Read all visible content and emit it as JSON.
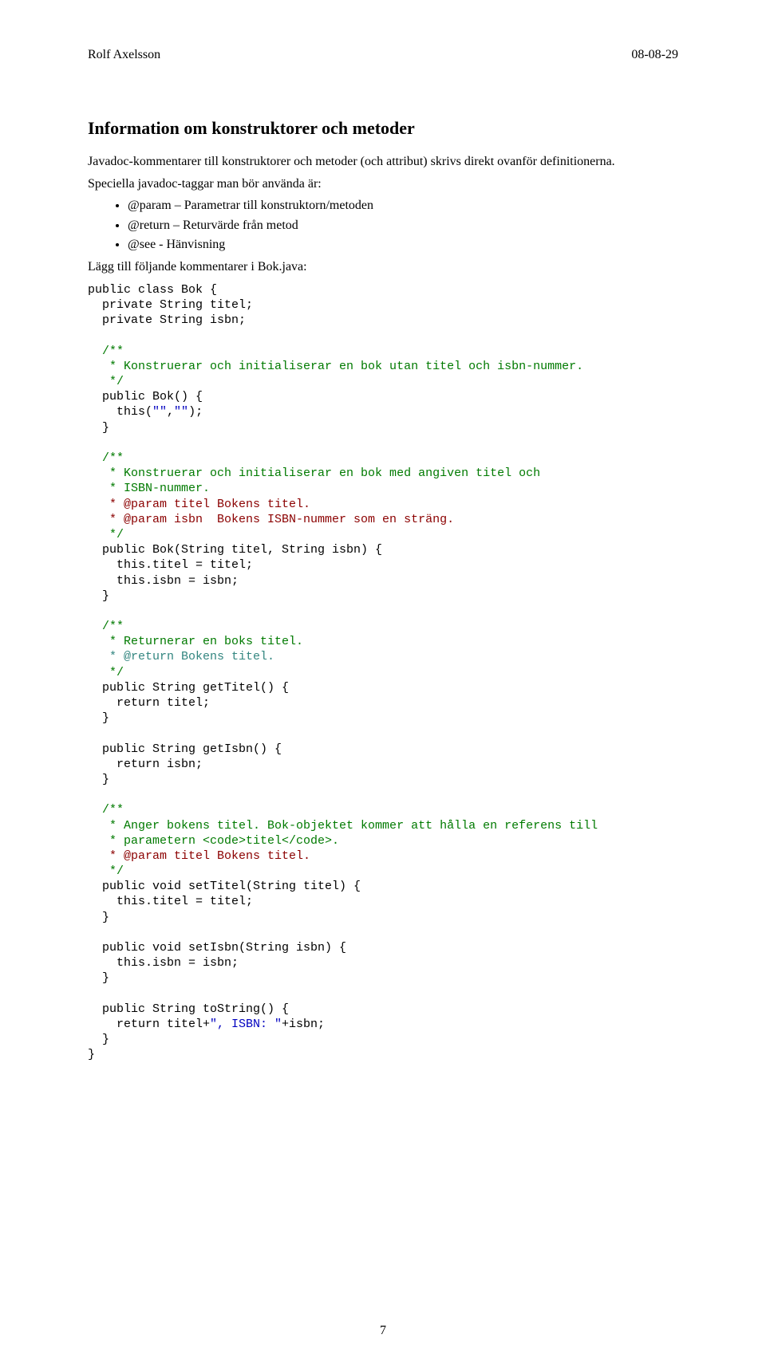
{
  "header": {
    "author": "Rolf Axelsson",
    "date": "08-08-29"
  },
  "title": "Information om konstruktorer och metoder",
  "intro": "Javadoc-kommentarer till konstruktorer och metoder (och attribut) skrivs direkt ovanför definitionerna.",
  "tagLead": "Speciella javadoc-taggar man bör använda är:",
  "bullets": [
    "@param – Parametrar till konstruktorn/metoden",
    "@return – Returvärde från metod",
    "@see - Hänvisning"
  ],
  "preCode": "Lägg till följande kommentarer i Bok.java:",
  "code": {
    "l01": "public class Bok {",
    "l02": "  private String titel;",
    "l03": "  private String isbn;",
    "l04a": "  /**",
    "l04b": "   * Konstruerar och initialiserar en bok utan titel och isbn-nummer.",
    "l04c": "   */",
    "l05": "  public Bok() {",
    "l06a": "    this(",
    "l06b": "\"\"",
    "l06c": ",",
    "l06d": "\"\"",
    "l06e": ");",
    "l07": "  }",
    "l08a": "  /**",
    "l08b": "   * Konstruerar och initialiserar en bok med angiven titel och ",
    "l08c": "   * ISBN-nummer.",
    "l08d": "   * @param titel Bokens titel.",
    "l08e": "   * @param isbn  Bokens ISBN-nummer som en sträng.",
    "l08f": "   */",
    "l09": "  public Bok(String titel, String isbn) {",
    "l10": "    this.titel = titel;",
    "l11": "    this.isbn = isbn;",
    "l12": "  }",
    "l13a": "  /**",
    "l13b": "   * Returnerar en boks titel.",
    "l13c": "   * @return Bokens titel.",
    "l13d": "   */",
    "l14": "  public String getTitel() {",
    "l15": "    return titel;",
    "l16": "  }",
    "l17": "  public String getIsbn() {",
    "l18": "    return isbn;",
    "l19": "  }",
    "l20a": "  /**",
    "l20b": "   * Anger bokens titel. Bok-objektet kommer att hålla en referens till",
    "l20c": "   * parametern <code>titel</code>.",
    "l20d": "   * @param titel Bokens titel.",
    "l20e": "   */",
    "l21": "  public void setTitel(String titel) {",
    "l22": "    this.titel = titel;",
    "l23": "  }",
    "l24": "  public void setIsbn(String isbn) {",
    "l25": "    this.isbn = isbn;",
    "l26": "  }",
    "l27": "  public String toString() {",
    "l28a": "    return titel+",
    "l28b": "\", ISBN: \"",
    "l28c": "+isbn;",
    "l29": "  }",
    "l30": "}"
  },
  "pageNumber": "7"
}
